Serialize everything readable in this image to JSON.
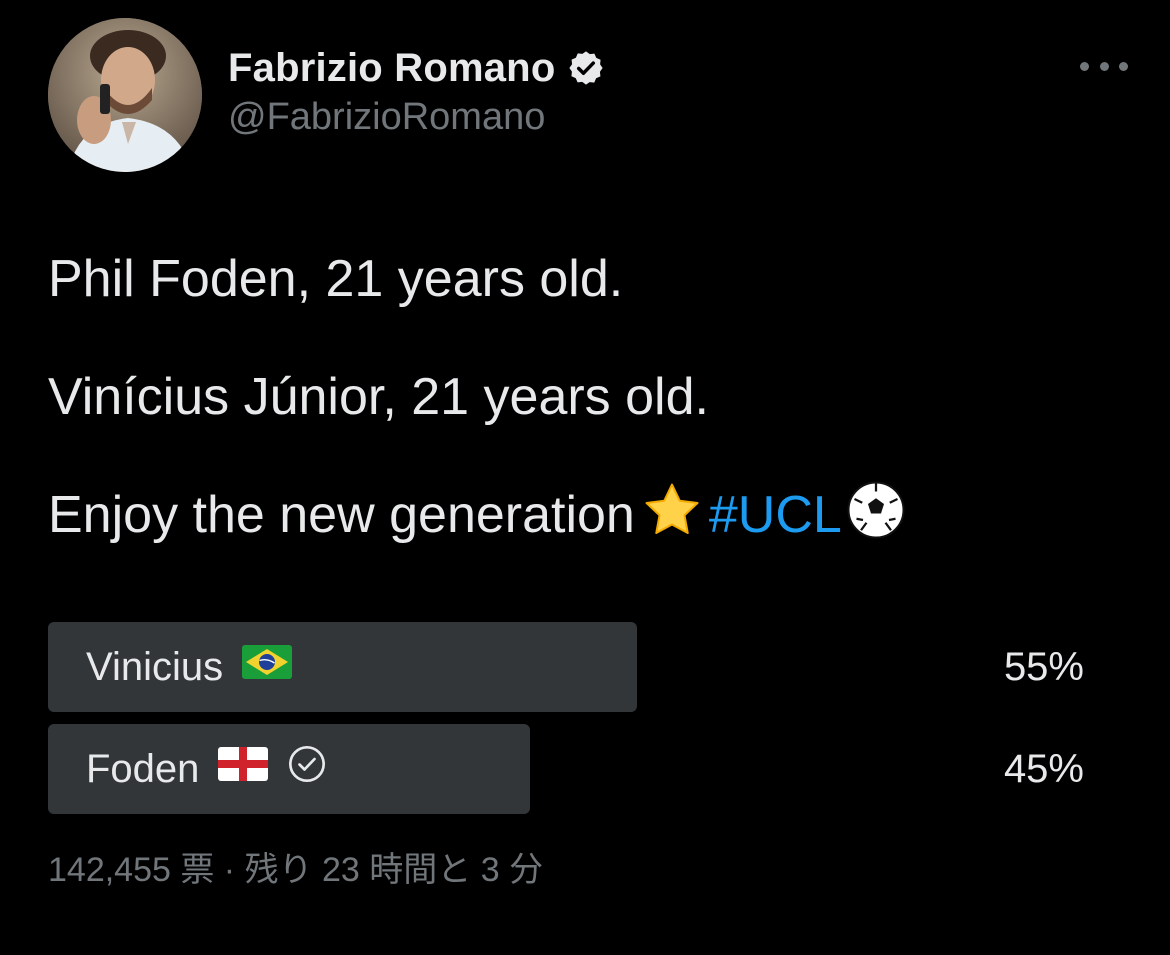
{
  "author": {
    "display_name": "Fabrizio Romano",
    "handle": "@FabrizioRomano",
    "verified": true,
    "avatar_icon": "profile-photo"
  },
  "tweet": {
    "line1": "Phil Foden, 21 years old.",
    "line2": "Vinícius Júnior, 21 years old.",
    "line3_text": "Enjoy the new generation",
    "line3_emoji": "star-emoji",
    "hashtag": "#UCL",
    "trailing_emoji": "soccer-ball-emoji"
  },
  "poll": {
    "options": [
      {
        "label": "Vinicius",
        "flag": "brazil-flag",
        "percent_text": "55%",
        "percent": 55,
        "selected": false
      },
      {
        "label": "Foden",
        "flag": "england-flag",
        "percent_text": "45%",
        "percent": 45,
        "selected": true
      }
    ],
    "votes": "142,455",
    "votes_unit": "票",
    "separator": " · ",
    "time_left": "残り 23 時間と 3 分"
  },
  "colors": {
    "background": "#000000",
    "text": "#e7e9ea",
    "secondary": "#71767b",
    "link": "#1d9bf0",
    "poll_bar": "#333639"
  }
}
